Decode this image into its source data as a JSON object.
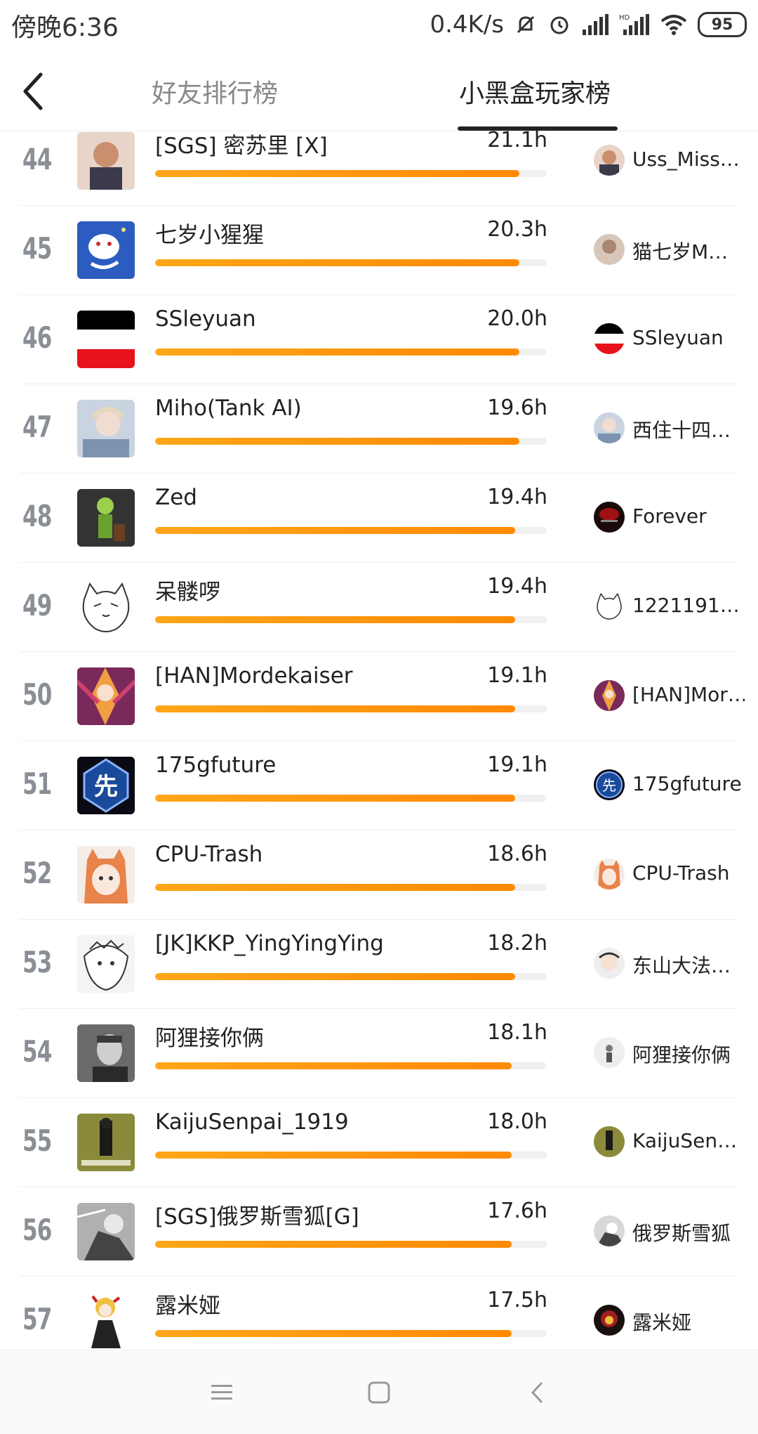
{
  "status": {
    "time": "傍晚6:36",
    "speed": "0.4K/s",
    "battery": "95"
  },
  "header": {
    "tab_friends": "好友排行榜",
    "tab_players": "小黑盒玩家榜"
  },
  "rows": [
    {
      "rank": "44",
      "name": "[SGS] 密苏里 [X]",
      "hours": "21.1h",
      "progress": 0.93,
      "steam": "Uss_Miss…",
      "color": "#c98f6e",
      "bg": "#e8d4c8"
    },
    {
      "rank": "45",
      "name": "七岁小猩猩",
      "hours": "20.3h",
      "progress": 0.93,
      "steam": "猫七岁M…",
      "color": "#1f4ba8",
      "bg": "#2c5cc0"
    },
    {
      "rank": "46",
      "name": "SSleyuan",
      "hours": "20.0h",
      "progress": 0.93,
      "steam": "SSleyuan",
      "color": "#000000",
      "bg": "#ffffff"
    },
    {
      "rank": "47",
      "name": "Miho(Tank AI)",
      "hours": "19.6h",
      "progress": 0.93,
      "steam": "西住十四…",
      "color": "#8aa0b8",
      "bg": "#c9d4e0"
    },
    {
      "rank": "48",
      "name": "Zed",
      "hours": "19.4h",
      "progress": 0.92,
      "steam": "Forever",
      "color": "#2a2a2a",
      "bg": "#333333"
    },
    {
      "rank": "49",
      "name": "呆髅啰",
      "hours": "19.4h",
      "progress": 0.92,
      "steam": "1221191…",
      "color": "#ffffff",
      "bg": "#ffffff"
    },
    {
      "rank": "50",
      "name": "[HAN]Mordekaiser",
      "hours": "19.1h",
      "progress": 0.92,
      "steam": "[HAN]Mor…",
      "color": "#c03868",
      "bg": "#7a2a5a"
    },
    {
      "rank": "51",
      "name": "175gfuture",
      "hours": "19.1h",
      "progress": 0.92,
      "steam": "175gfuture",
      "color": "#1a4a9a",
      "bg": "#0a0a14"
    },
    {
      "rank": "52",
      "name": "CPU-Trash",
      "hours": "18.6h",
      "progress": 0.92,
      "steam": "CPU-Trash",
      "color": "#e8834a",
      "bg": "#f4ece6"
    },
    {
      "rank": "53",
      "name": "[JK]KKP_YingYingYing",
      "hours": "18.2h",
      "progress": 0.92,
      "steam": "东山大法…",
      "color": "#dddddd",
      "bg": "#f4f4f4"
    },
    {
      "rank": "54",
      "name": "阿狸接你俩",
      "hours": "18.1h",
      "progress": 0.91,
      "steam": "阿狸接你俩",
      "color": "#555555",
      "bg": "#777777"
    },
    {
      "rank": "55",
      "name": "KaijuSenpai_1919",
      "hours": "18.0h",
      "progress": 0.91,
      "steam": "KaijuSen…",
      "color": "#a8a848",
      "bg": "#7a7a2e"
    },
    {
      "rank": "56",
      "name": "[SGS]俄罗斯雪狐[G]",
      "hours": "17.6h",
      "progress": 0.91,
      "steam": "俄罗斯雪狐",
      "color": "#666666",
      "bg": "#999999"
    },
    {
      "rank": "57",
      "name": "露米娅",
      "hours": "17.5h",
      "progress": 0.91,
      "steam": "露米娅",
      "color": "#e0a030",
      "bg": "#ffffff"
    }
  ],
  "nav": {
    "menu": "menu-icon",
    "home": "home-icon",
    "back": "back-icon"
  }
}
